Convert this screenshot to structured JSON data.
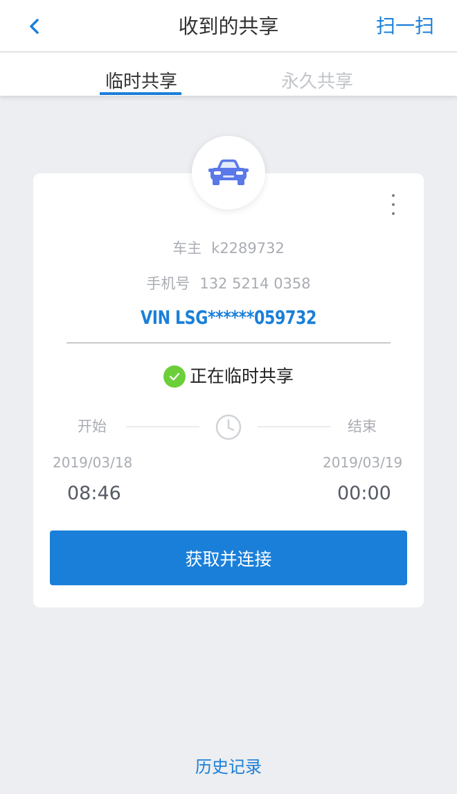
{
  "header": {
    "title": "收到的共享",
    "scan_label": "扫一扫"
  },
  "tabs": [
    {
      "label": "临时共享",
      "active": true
    },
    {
      "label": "永久共享",
      "active": false
    }
  ],
  "card": {
    "owner_label": "车主",
    "owner_value": "k2289732",
    "phone_label": "手机号",
    "phone_value": "132 5214 0358",
    "vin": "VIN LSG******059732",
    "status": "正在临时共享",
    "start_label": "开始",
    "end_label": "结束",
    "start_date": "2019/03/18",
    "start_time": "08:46",
    "end_date": "2019/03/19",
    "end_time": "00:00",
    "connect_button": "获取并连接"
  },
  "footer": {
    "history_link": "历史记录"
  },
  "colors": {
    "accent": "#1a7fd9",
    "success": "#6ccf3a",
    "background": "#eceef1",
    "car_icon": "#5a78e8"
  },
  "icons": [
    "back-chevron-icon",
    "car-icon",
    "more-vertical-icon",
    "check-circle-icon",
    "clock-icon"
  ]
}
